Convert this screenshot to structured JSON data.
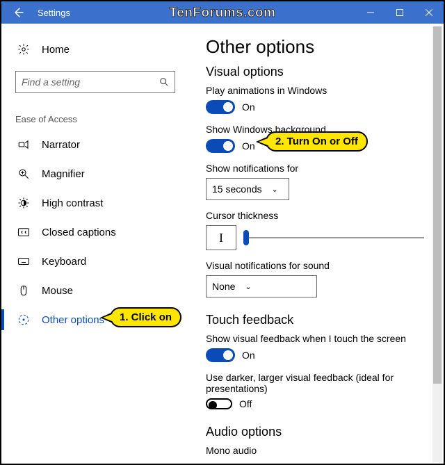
{
  "titlebar": {
    "title": "Settings"
  },
  "watermark": "TenForums.com",
  "sidebar": {
    "home": "Home",
    "search_placeholder": "Find a setting",
    "group": "Ease of Access",
    "items": [
      {
        "label": "Narrator"
      },
      {
        "label": "Magnifier"
      },
      {
        "label": "High contrast"
      },
      {
        "label": "Closed captions"
      },
      {
        "label": "Keyboard"
      },
      {
        "label": "Mouse"
      },
      {
        "label": "Other options"
      }
    ]
  },
  "main": {
    "title": "Other options",
    "visual_heading": "Visual options",
    "play_animations": {
      "label": "Play animations in Windows",
      "state": "On"
    },
    "show_background": {
      "label": "Show Windows background",
      "state": "On"
    },
    "notifications": {
      "label": "Show notifications for",
      "value": "15 seconds"
    },
    "cursor": {
      "label": "Cursor thickness",
      "sample": "I"
    },
    "visual_notif": {
      "label": "Visual notifications for sound",
      "value": "None"
    },
    "touch_heading": "Touch feedback",
    "touch_visual": {
      "label": "Show visual feedback when I touch the screen",
      "state": "On"
    },
    "touch_darker": {
      "label": "Use darker, larger visual feedback (ideal for presentations)",
      "state": "Off"
    },
    "audio_heading": "Audio options",
    "mono_audio": {
      "label": "Mono audio"
    }
  },
  "callouts": {
    "c1": "1. Click on",
    "c2": "2. Turn On or Off"
  }
}
